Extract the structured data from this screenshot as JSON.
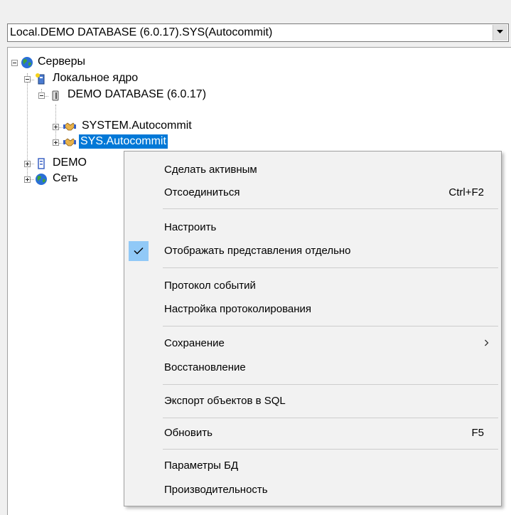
{
  "connection_selector": {
    "value": "Local.DEMO DATABASE (6.0.17).SYS(Autocommit)"
  },
  "tree": {
    "root_label": "Серверы",
    "local_core_label": "Локальное ядро",
    "database_label": "DEMO DATABASE (6.0.17)",
    "user_system_label": "SYSTEM.Autocommit",
    "user_sys_label": "SYS.Autocommit",
    "demo_server_label": "DEMO",
    "network_label": "Сеть"
  },
  "context_menu": {
    "make_active": "Сделать активным",
    "disconnect": "Отсоединиться",
    "disconnect_shortcut": "Ctrl+F2",
    "configure": "Настроить",
    "show_views_separately": "Отображать представления отдельно",
    "event_log": "Протокол событий",
    "logging_settings": "Настройка протоколирования",
    "save": "Сохранение",
    "restore": "Восстановление",
    "export_sql": "Экспорт объектов в SQL",
    "refresh": "Обновить",
    "refresh_shortcut": "F5",
    "db_parameters": "Параметры БД",
    "performance": "Производительность"
  },
  "state": {
    "selected_node": "SYS.Autocommit",
    "show_views_separately_checked": true
  },
  "colors": {
    "selection": "#0078d7",
    "check_highlight": "#91c9f7",
    "menu_background": "#f2f2f2"
  },
  "icons": {
    "servers": "globe-icon",
    "local_core": "local-core-icon",
    "database": "database-icon",
    "user": "handshake-user-icon",
    "server": "server-icon",
    "network": "globe-icon",
    "dropdown": "chevron-down-icon",
    "submenu": "chevron-right-icon",
    "check": "check-icon"
  }
}
